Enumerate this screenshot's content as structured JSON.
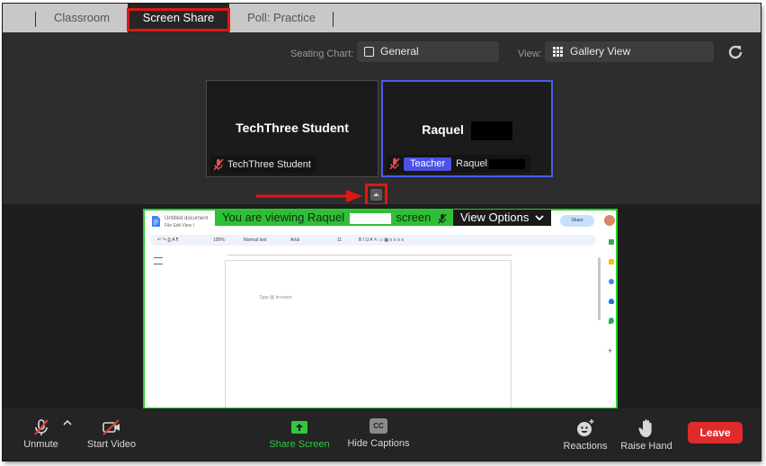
{
  "tabs": [
    {
      "label": "Classroom"
    },
    {
      "label": "Screen Share"
    },
    {
      "label": "Poll: Practice"
    }
  ],
  "header": {
    "seating_label": "Seating Chart:",
    "seating_value": "General",
    "view_label": "View:",
    "view_value": "Gallery View"
  },
  "tiles": [
    {
      "name": "TechThree Student",
      "footer": "TechThree Student"
    },
    {
      "name": "Raquel",
      "footer": "Raquel",
      "badge": "Teacher"
    }
  ],
  "share": {
    "banner_prefix": "You are viewing Raquel",
    "banner_suffix": "screen",
    "view_options": "View Options",
    "doc_title": "Untitled document",
    "doc_menu": "File   Edit   View   I",
    "doc_share": "Share",
    "doc_placeholder": "Type @ to insert",
    "doc_zoom": "100%",
    "doc_style": "Normal text",
    "doc_font": "Arial",
    "doc_fontsize": "11"
  },
  "controls": {
    "unmute": "Unmute",
    "start_video": "Start Video",
    "share_screen": "Share Screen",
    "hide_captions": "Hide Captions",
    "cc": "CC",
    "reactions": "Reactions",
    "raise_hand": "Raise Hand",
    "leave": "Leave"
  },
  "colors": {
    "accent_green": "#21d421",
    "teacher_badge": "#4b53e6",
    "leave_red": "#e02b2b",
    "annotation_red": "#e01616"
  }
}
